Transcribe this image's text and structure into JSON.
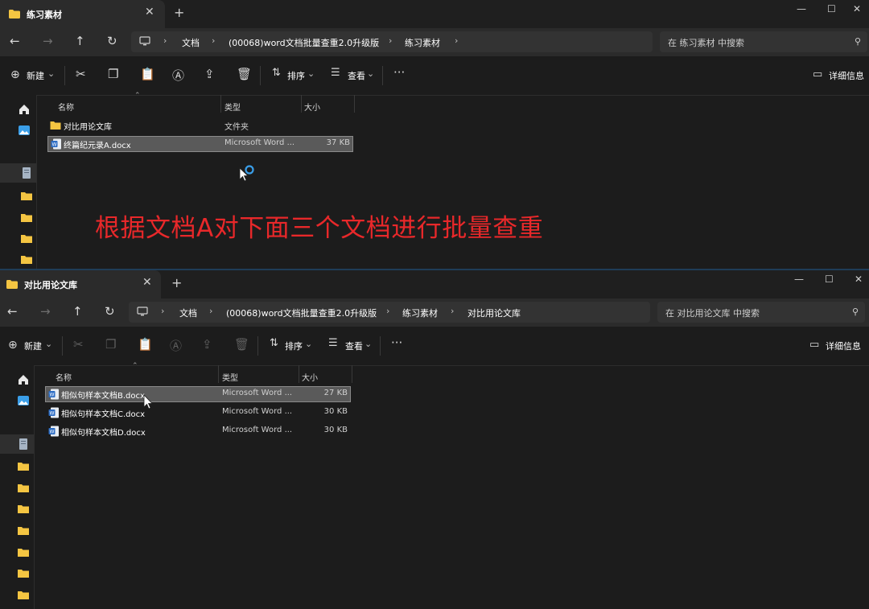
{
  "window1": {
    "tab_title": "练习素材",
    "breadcrumb": [
      "文档",
      "(00068)word文档批量查重2.0升级版",
      "练习素材"
    ],
    "search_placeholder": "在 练习素材 中搜索",
    "toolbar": {
      "new_label": "新建",
      "sort_label": "排序",
      "view_label": "查看",
      "details_label": "详细信息"
    },
    "columns": {
      "name": "名称",
      "type": "类型",
      "size": "大小"
    },
    "files": [
      {
        "name": "对比用论文库",
        "type": "文件夹",
        "size": "",
        "icon": "folder-icon",
        "selected": false
      },
      {
        "name": "终篇纪元录A.docx",
        "type": "Microsoft Word ...",
        "size": "37 KB",
        "icon": "word-doc-icon",
        "selected": true
      }
    ]
  },
  "window2": {
    "tab_title": "对比用论文库",
    "breadcrumb": [
      "文档",
      "(00068)word文档批量查重2.0升级版",
      "练习素材",
      "对比用论文库"
    ],
    "search_placeholder": "在 对比用论文库 中搜索",
    "toolbar": {
      "new_label": "新建",
      "sort_label": "排序",
      "view_label": "查看",
      "details_label": "详细信息"
    },
    "columns": {
      "name": "名称",
      "type": "类型",
      "size": "大小"
    },
    "files": [
      {
        "name": "相似句样本文档B.docx",
        "type": "Microsoft Word ...",
        "size": "27 KB",
        "icon": "word-doc-icon",
        "selected": true
      },
      {
        "name": "相似句样本文档C.docx",
        "type": "Microsoft Word ...",
        "size": "30 KB",
        "icon": "word-doc-icon",
        "selected": false
      },
      {
        "name": "相似句样本文档D.docx",
        "type": "Microsoft Word ...",
        "size": "30 KB",
        "icon": "word-doc-icon",
        "selected": false
      }
    ]
  },
  "overlay_caption": "根据文档A对下面三个文档进行批量查重",
  "colors": {
    "caption": "#e8282a",
    "folder": "#f4c542",
    "word": "#2b6cc4",
    "accent": "#3a9ee8"
  }
}
